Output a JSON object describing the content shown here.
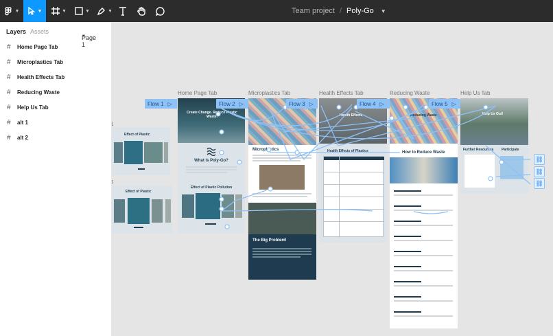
{
  "toolbar": {
    "tools": [
      "main-menu",
      "move",
      "frame",
      "shape",
      "pen",
      "text",
      "hand",
      "comment"
    ],
    "active_tool": "move",
    "team": "Team project",
    "separator": "/",
    "project": "Poly-Go"
  },
  "panel": {
    "tab_layers": "Layers",
    "tab_assets": "Assets",
    "page_selector": "Page 1",
    "layers": [
      {
        "icon": "frame-icon",
        "label": "Home Page Tab"
      },
      {
        "icon": "frame-icon",
        "label": "Microplastics Tab"
      },
      {
        "icon": "frame-icon",
        "label": "Health Effects Tab"
      },
      {
        "icon": "frame-icon",
        "label": "Reducing Waste"
      },
      {
        "icon": "frame-icon",
        "label": "Help Us Tab"
      },
      {
        "icon": "frame-icon",
        "label": "alt 1"
      },
      {
        "icon": "frame-icon",
        "label": "alt 2"
      }
    ]
  },
  "canvas": {
    "frame_labels": [
      "Home Page Tab",
      "Microplastics Tab",
      "Health Effects Tab",
      "Reducing Waste",
      "Help Us Tab"
    ],
    "alt_labels": [
      "1",
      "2"
    ],
    "flows": [
      "Flow 1",
      "Flow 2",
      "Flow 3",
      "Flow 4",
      "Flow 5"
    ],
    "home": {
      "hero": "Create Change. Reduce Plastic Waste.",
      "about_title": "What is Poly-Go?",
      "effects_title": "Effect of Plastic Pollution"
    },
    "alt_effect_title": "Effect of Plastic",
    "micro": {
      "heading": "Microplastics",
      "problem": "The Big Problem!"
    },
    "health": {
      "heading": "Health Effects of Plastics",
      "hero": "Health Effects"
    },
    "reduce": {
      "heading": "How to Reduce Waste",
      "hero": "Reducing Waste"
    },
    "help": {
      "hero": "Help Us Out!",
      "resources": "Further Resources",
      "participate": "Participate"
    },
    "colors": {
      "prototype_blue": "#8ec1f6",
      "accent": "#0d99ff",
      "dark_navy": "#1e3b4f"
    }
  }
}
